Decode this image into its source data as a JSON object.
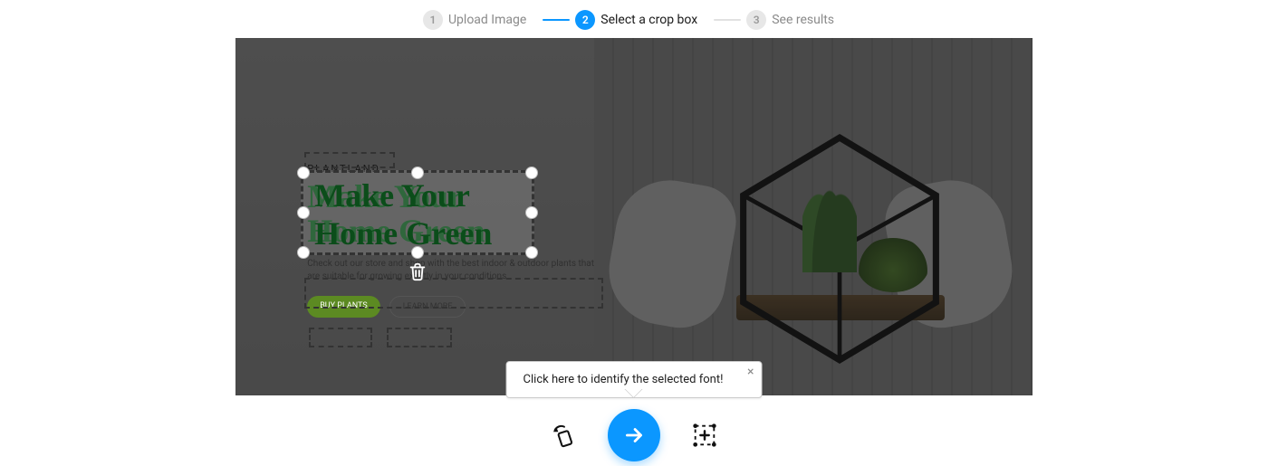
{
  "stepper": {
    "steps": [
      {
        "num": "1",
        "label": "Upload Image",
        "active": false
      },
      {
        "num": "2",
        "label": "Select a crop box",
        "active": true
      },
      {
        "num": "3",
        "label": "See results",
        "active": false
      }
    ]
  },
  "image_content": {
    "logo": "PLANTLAND",
    "headline_line1": "Make Your",
    "headline_line2": "Home Green",
    "subcopy": "Check out our store and shop with the best indoor & outdoor plants that are suitable for growing exactly in your conditions",
    "button_primary": "BUY PLANTS",
    "button_secondary": "LEARN MORE"
  },
  "crop": {
    "text_line1": "Make Your",
    "text_line2": "Home Green"
  },
  "tooltip": {
    "text": "Click here to identify the selected font!",
    "close": "×"
  },
  "actions": {
    "rotate": "rotate-icon",
    "submit": "arrow-right-icon",
    "addselection": "add-selection-icon"
  },
  "colors": {
    "accent": "#0b97ff",
    "headline": "#0b4d1a"
  }
}
